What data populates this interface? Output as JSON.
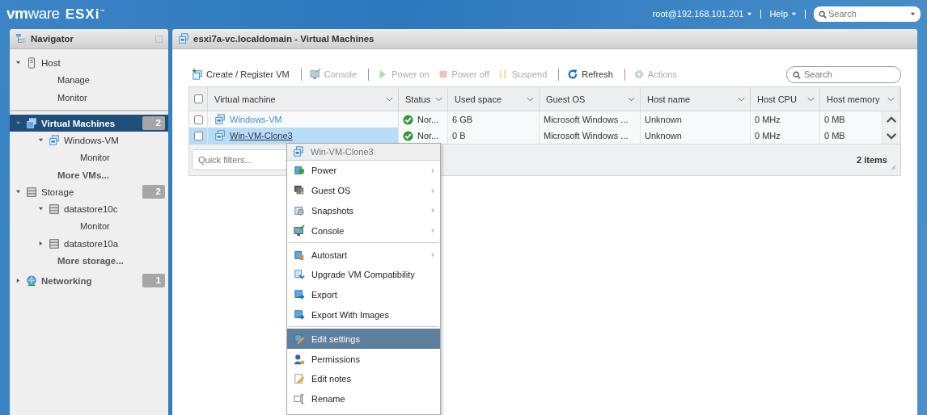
{
  "header": {
    "logo": "**vm**ware",
    "product": "ESXi$^{™}$",
    "user": "root@192.168.101.201",
    "help": "Help",
    "search": {
      "placeholder": "Search"
    }
  },
  "navigator": {
    "title": "Navigator",
    "sections": [
      [
        {
          "label": "Host",
          "kind": "host",
          "expanded": true,
          "selected": false,
          "children": [
            {
              "label": "Manage",
              "kind": "link",
              "selected": false
            },
            {
              "label": "Monitor",
              "kind": "link",
              "selected": false
            }
          ]
        }
      ],
      [
        {
          "label": "Virtual Machines",
          "kind": "vms",
          "expanded": true,
          "selected": true,
          "badge": "2",
          "children": [
            {
              "label": "Windows-VM",
              "kind": "vm",
              "expanded": true,
              "selected": false,
              "children": [
                {
                  "label": "Monitor",
                  "kind": "link",
                  "selected": false
                }
              ]
            },
            {
              "label": "More VMs...",
              "kind": "more",
              "selected": false
            }
          ]
        },
        {
          "label": "Storage",
          "kind": "storage",
          "expanded": true,
          "selected": false,
          "badge": "2",
          "children": [
            {
              "label": "datastore10c",
              "kind": "datastore",
              "expanded": true,
              "selected": false,
              "children": [
                {
                  "label": "Monitor",
                  "kind": "link",
                  "selected": false
                }
              ]
            },
            {
              "label": "datastore10a",
              "kind": "datastore",
              "expanded": false,
              "selected": false
            },
            {
              "label": "More storage...",
              "kind": "more",
              "selected": false
            }
          ]
        },
        {
          "label": "Networking",
          "kind": "network",
          "expanded": false,
          "selected": false,
          "badge": "1"
        }
      ]
    ]
  },
  "main": {
    "title": "esxi7a-vc.localdomain - Virtual Machines",
    "toolbar": [
      [
        {
          "label": "Create / Register VM",
          "kind": "create",
          "disabled": false
        }
      ],
      [
        {
          "label": "Console",
          "kind": "console",
          "disabled": true
        }
      ],
      [
        {
          "label": "Power on",
          "kind": "power_on",
          "disabled": true
        },
        {
          "label": "Power off",
          "kind": "power_off",
          "disabled": true
        },
        {
          "label": "Suspend",
          "kind": "suspend",
          "disabled": true
        }
      ],
      [
        {
          "label": "Refresh",
          "kind": "refresh",
          "disabled": false
        }
      ],
      [
        {
          "label": "Actions",
          "kind": "actions",
          "disabled": true
        }
      ]
    ],
    "search": {
      "placeholder": "Search"
    },
    "table": {
      "select_all": {
        "checked": false
      },
      "columns": [
        "Virtual machine",
        "Status",
        "Used space",
        "Guest OS",
        "Host name",
        "Host CPU",
        "Host memory"
      ],
      "rows": [
        {
          "checked": false,
          "selected": false,
          "cells": [
            "Windows-VM",
            "Nor...",
            "6 GB",
            "Microsoft Windows ...",
            "Unknown",
            "0 MHz",
            "0 MB"
          ]
        },
        {
          "checked": false,
          "selected": true,
          "cells": [
            "Win-VM-Clone3",
            "Nor...",
            "0 B",
            "Microsoft Windows ...",
            "Unknown",
            "0 MHz",
            "0 MB"
          ]
        }
      ],
      "quick_filters": {
        "placeholder": "Quick filters..."
      },
      "count": "2 items"
    }
  },
  "context_menu": {
    "title": "Win-VM-Clone3",
    "sections": [
      [
        {
          "label": "Power",
          "kind": "power",
          "submenu": true,
          "selected": false
        },
        {
          "label": "Guest OS",
          "kind": "guest",
          "submenu": true,
          "selected": false
        },
        {
          "label": "Snapshots",
          "kind": "snapshot",
          "submenu": true,
          "selected": false
        },
        {
          "label": "Console",
          "kind": "console",
          "submenu": true,
          "selected": false
        }
      ],
      [
        {
          "label": "Autostart",
          "kind": "autostart",
          "submenu": true,
          "selected": false
        },
        {
          "label": "Upgrade VM Compatibility",
          "kind": "upgrade",
          "submenu": false,
          "selected": false
        },
        {
          "label": "Export",
          "kind": "export",
          "submenu": false,
          "selected": false
        },
        {
          "label": "Export With Images",
          "kind": "export",
          "submenu": false,
          "selected": false
        }
      ],
      [
        {
          "label": "Edit settings",
          "kind": "settings",
          "submenu": false,
          "selected": true
        },
        {
          "label": "Permissions",
          "kind": "permissions",
          "submenu": false,
          "selected": false
        },
        {
          "label": "Edit notes",
          "kind": "notes",
          "submenu": false,
          "selected": false
        },
        {
          "label": "Rename",
          "kind": "rename",
          "submenu": false,
          "selected": false
        }
      ]
    ]
  }
}
